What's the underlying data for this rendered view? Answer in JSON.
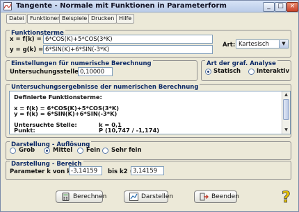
{
  "window": {
    "title": "Tangente - Normale mit Funktionen in Parameterform"
  },
  "menu": [
    "Datei",
    "Funktionen",
    "Beispiele",
    "Drucken",
    "Hilfe"
  ],
  "funktionsterme": {
    "label": "Funktionsterme",
    "x_label": "x = f(k) =",
    "x_value": "6*COS(K)+5*COS(3*K)",
    "y_label": "y = g(k) =",
    "y_value": "6*SIN(K)+6*SIN(-3*K)",
    "art_label": "Art:",
    "art_value": "Kartesisch"
  },
  "einstellungen": {
    "label": "Einstellungen für numerische Berechnung",
    "stelle_label": "Untersuchungsstelle k =",
    "stelle_value": "0,10000"
  },
  "analyse": {
    "label": "Art der graf. Analyse",
    "options": [
      "Statisch",
      "Interaktiv"
    ],
    "selected": "Statisch"
  },
  "ergebnisse": {
    "label": "Untersuchungsergebnisse der numerischen Berechnung",
    "lines": [
      "Definierte Funktionsterme:",
      "",
      "x = f(k) = 6*COS(K)+5*COS(3*K)",
      "y = f(k) = 6*SIN(K)+6*SIN(-3*K)",
      "",
      "Untersuchte Stelle:",
      "Punkt:"
    ],
    "stelle_value": "k = 0,1",
    "punkt_value": "P (10,747 / -1,174)"
  },
  "aufloesung": {
    "label": "Darstellung - Auflösung",
    "options": [
      "Grob",
      "Mittel",
      "Fein",
      "Sehr fein"
    ],
    "selected": "Mittel"
  },
  "bereich": {
    "label": "Darstellung - Bereich",
    "k1_label": "Parameter k von k1 =",
    "k1_value": "-3,14159",
    "k2_label": "bis k2 =",
    "k2_value": "3,14159"
  },
  "buttons": {
    "berechnen": "Berechnen",
    "darstellen": "Darstellen",
    "beenden": "Beenden"
  },
  "colors": {
    "group_label": "#0d2a66",
    "titlebar": "#c4d3ee"
  },
  "icons": [
    "app-icon",
    "minimize-icon",
    "maximize-icon",
    "close-icon",
    "calculator-icon",
    "chart-icon",
    "exit-icon",
    "help-icon"
  ]
}
